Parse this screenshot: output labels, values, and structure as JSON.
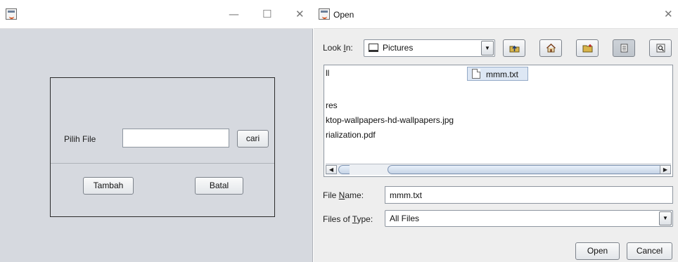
{
  "left_window": {
    "controls": {
      "minimize": "—",
      "maximize": "☐",
      "close": "✕"
    },
    "form": {
      "file_label": "Pilih File",
      "file_value": "",
      "browse_label": "cari",
      "add_label": "Tambah",
      "cancel_label": "Batal"
    }
  },
  "dialog": {
    "title": "Open",
    "close": "✕",
    "look_in": {
      "label_pre": "Look ",
      "label_key": "I",
      "label_post": "n:",
      "value": "Pictures"
    },
    "toolbar": [
      "up-one-level-icon",
      "home-icon",
      "new-folder-icon",
      "list-view-icon",
      "details-view-icon"
    ],
    "files": [
      "ll",
      "res",
      "ktop-wallpapers-hd-wallpapers.jpg",
      "rialization.pdf"
    ],
    "selected_file": "mmm.txt",
    "file_name": {
      "label_pre": "File ",
      "label_key": "N",
      "label_post": "ame:",
      "value": "mmm.txt"
    },
    "file_type": {
      "label_pre": "Files of ",
      "label_key": "T",
      "label_post": "ype:",
      "value": "All Files"
    },
    "open_label": "Open",
    "cancel_label": "Cancel"
  }
}
